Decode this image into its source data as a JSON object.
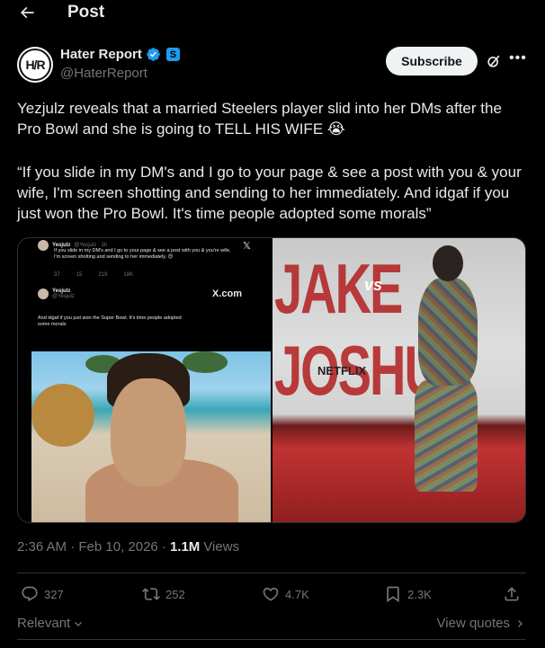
{
  "header": {
    "title": "Post",
    "back_icon": "arrow-left-icon"
  },
  "author": {
    "name": "Hater Report",
    "handle": "@HaterReport",
    "avatar_text": "H/R",
    "verified": true,
    "subscribe_label": "Subscribe",
    "sub_badge": "S"
  },
  "post": {
    "text_1": "Yezjulz reveals that a married Steelers player slid into her DMs after the Pro Bowl and she is going to TELL HIS WIFE 😭",
    "text_2": "“If you slide in my DM's and I go to your page & see a post with you & your wife, I'm screen shotting and sending to her immediately. And idgaf if you just won the Pro Bowl. It's time people adopted some morals”",
    "embed": {
      "name": "Yesjulz",
      "handle_time": "@Yesjulz · 1h",
      "tweet_1": "If you slide in my DM's and I go to your page & see a post with you & you're wife, I'm screen shotting and sending to her immediately. 😊",
      "stats": [
        "37",
        "15",
        "219",
        "18K"
      ],
      "tweet_2": "And idgaf if you just won the Super Bowl. It's time people adopted some morals",
      "handle_2": "@Yesjulz",
      "xcom": "X.com"
    },
    "right_image": {
      "banner": "JAKE JOSHUA",
      "vs": "vs",
      "netflix": "NETFLIX"
    },
    "time": "2:36 AM · Feb 10, 2026 ·",
    "views": "1.1M",
    "views_label": "Views"
  },
  "actions": {
    "replies": "327",
    "reposts": "252",
    "likes": "4.7K",
    "bookmarks": "2.3K"
  },
  "footer": {
    "relevant": "Relevant",
    "view_quotes": "View quotes"
  },
  "colors": {
    "accent": "#1d9bf0",
    "muted": "#71767b",
    "text": "#e7e9ea",
    "bg": "#000000"
  }
}
